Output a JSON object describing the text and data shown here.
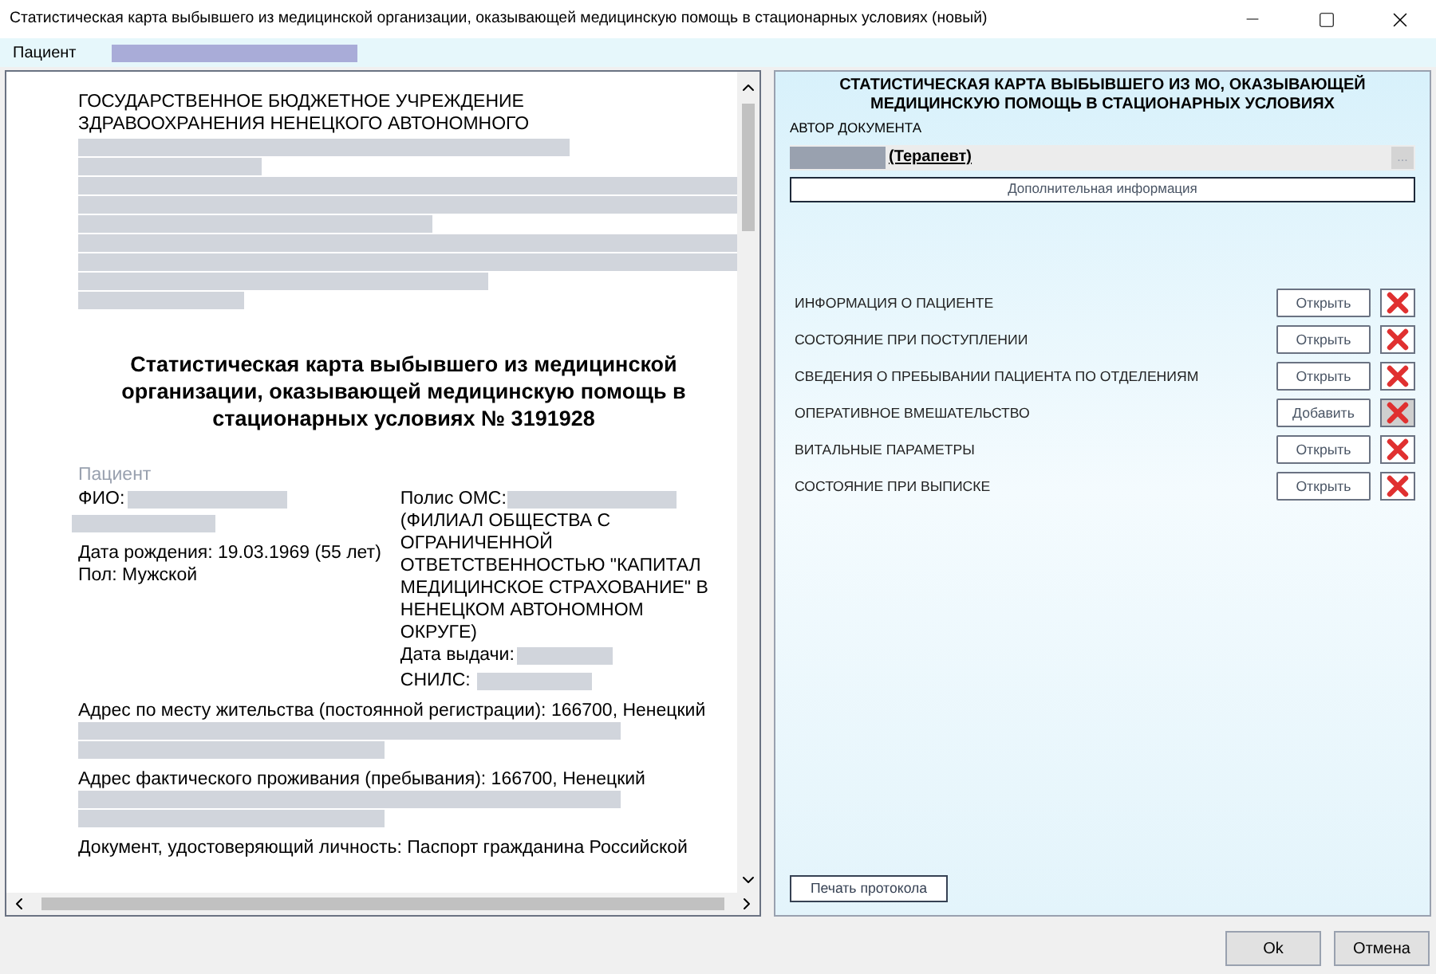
{
  "window": {
    "title": "Статистическая карта выбывшего из медицинской организации, оказывающей медицинскую помощь в стационарных условиях (новый)"
  },
  "patient_bar": {
    "label": "Пациент"
  },
  "document": {
    "organization": "ГОСУДАРСТВЕННОЕ БЮДЖЕТНОЕ УЧРЕЖДЕНИЕ ЗДРАВООХРАНЕНИЯ НЕНЕЦКОГО АВТОНОМНОГО",
    "title": "Статистическая карта выбывшего из медицинской организации, оказывающей медицинскую помощь в стационарных условиях № 3191928",
    "patient_heading": "Пациент",
    "fio_label": "ФИО:",
    "birth_date": "Дата рождения: 19.03.1969 (55 лет)",
    "sex": "Пол: Мужской",
    "policy_label": "Полис ОМС:",
    "insurer": "(ФИЛИАЛ ОБЩЕСТВА С ОГРАНИЧЕННОЙ ОТВЕТСТВЕННОСТЬЮ \"КАПИТАЛ МЕДИЦИНСКОЕ СТРАХОВАНИЕ\" В НЕНЕЦКОМ АВТОНОМНОМ ОКРУГЕ)",
    "issue_date_label": "Дата выдачи:",
    "snils_label": "СНИЛС:",
    "registration_address": "Адрес по месту жительства (постоянной регистрации): 166700, Ненецкий",
    "actual_address": "Адрес фактического проживания (пребывания): 166700, Ненецкий",
    "identity_document": "Документ, удостоверяющий личность: Паспорт гражданина Российской"
  },
  "form": {
    "title": "СТАТИСТИЧЕСКАЯ КАРТА ВЫБЫВШЕГО ИЗ МО, ОКАЗЫВАЮЩЕЙ МЕДИЦИНСКУЮ ПОМОЩЬ В СТАЦИОНАРНЫХ УСЛОВИЯХ",
    "author_label": "АВТОР ДОКУМЕНТА",
    "author_role": "(Терапевт)",
    "author_button": "...",
    "extra_info_button": "Дополнительная информация",
    "sections": [
      {
        "label": "ИНФОРМАЦИЯ О ПАЦИЕНТЕ",
        "action": "Открыть",
        "delete_disabled": false
      },
      {
        "label": "СОСТОЯНИЕ ПРИ ПОСТУПЛЕНИИ",
        "action": "Открыть",
        "delete_disabled": false
      },
      {
        "label": "СВЕДЕНИЯ О ПРЕБЫВАНИИ ПАЦИЕНТА ПО ОТДЕЛЕНИЯМ",
        "action": "Открыть",
        "delete_disabled": false
      },
      {
        "label": "ОПЕРАТИВНОЕ ВМЕШАТЕЛЬСТВО",
        "action": "Добавить",
        "delete_disabled": true
      },
      {
        "label": "ВИТАЛЬНЫЕ ПАРАМЕТРЫ",
        "action": "Открыть",
        "delete_disabled": false
      },
      {
        "label": "СОСТОЯНИЕ ПРИ ВЫПИСКЕ",
        "action": "Открыть",
        "delete_disabled": false
      }
    ],
    "print_button": "Печать протокола"
  },
  "buttons": [
    {
      "label": "Ok"
    },
    {
      "label": "Отмена"
    }
  ]
}
